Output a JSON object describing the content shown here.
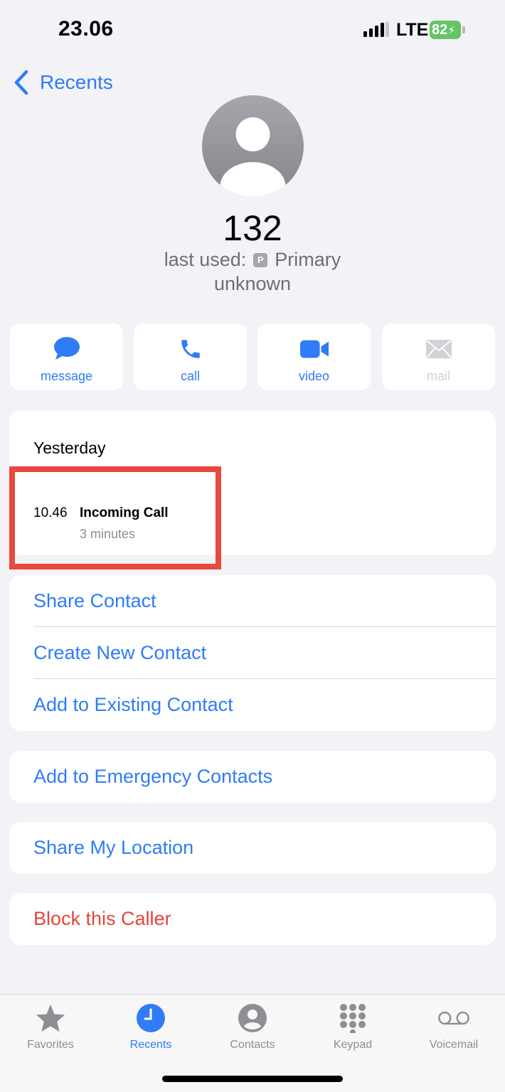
{
  "status_bar": {
    "time": "23.06",
    "network": "LTE",
    "battery": "82"
  },
  "nav": {
    "back_label": "Recents"
  },
  "contact": {
    "number": "132",
    "last_used_prefix": "last used:",
    "sim_badge": "P",
    "sim_name": "Primary",
    "label": "unknown"
  },
  "actions": [
    {
      "label": "message",
      "icon": "message-bubble-icon",
      "enabled": true
    },
    {
      "label": "call",
      "icon": "phone-icon",
      "enabled": true
    },
    {
      "label": "video",
      "icon": "video-camera-icon",
      "enabled": true
    },
    {
      "label": "mail",
      "icon": "envelope-icon",
      "enabled": false
    }
  ],
  "recent_calls": {
    "day": "Yesterday",
    "calls": [
      {
        "time": "10.46",
        "type": "Incoming Call",
        "duration": "3 minutes"
      }
    ]
  },
  "contact_options": [
    "Share Contact",
    "Create New Contact",
    "Add to Existing Contact"
  ],
  "emergency": "Add to Emergency Contacts",
  "location": "Share My Location",
  "block": "Block this Caller",
  "tab_bar": {
    "active": "Recents",
    "tabs": [
      {
        "label": "Favorites",
        "icon": "star-icon"
      },
      {
        "label": "Recents",
        "icon": "clock-icon"
      },
      {
        "label": "Contacts",
        "icon": "person-circle-icon"
      },
      {
        "label": "Keypad",
        "icon": "keypad-icon"
      },
      {
        "label": "Voicemail",
        "icon": "voicemail-icon"
      }
    ]
  },
  "colors": {
    "accent": "#2f7cf6",
    "destructive": "#e5453a",
    "highlight_box": "#e8493e",
    "background": "#f2f2f7",
    "battery": "#65c466"
  }
}
